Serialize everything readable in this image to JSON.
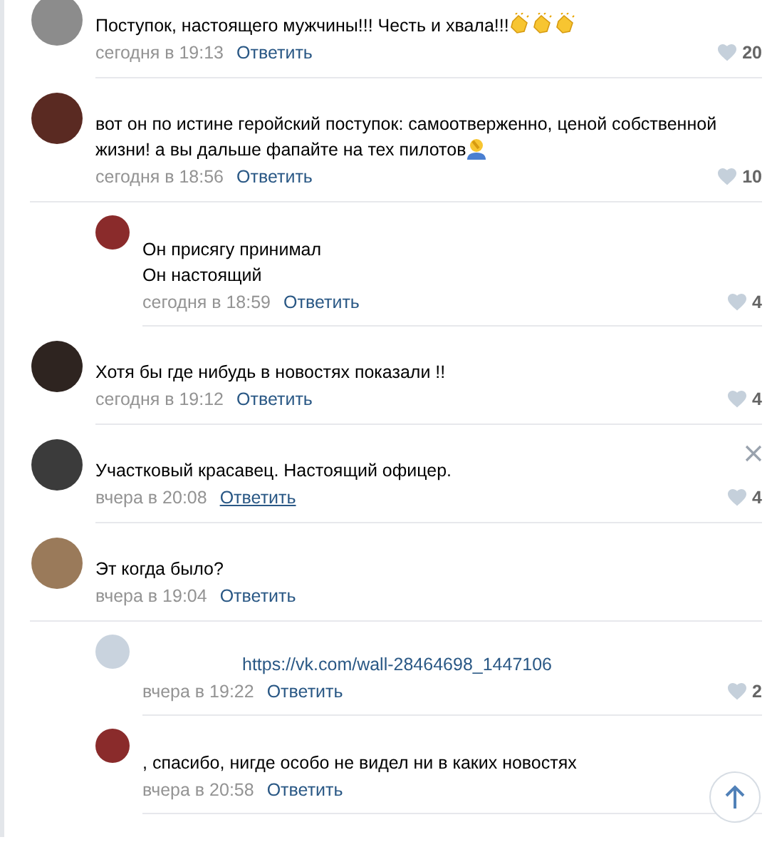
{
  "comments": [
    {
      "text": "Поступок, настоящего мужчины!!! Честь и хвала!!!",
      "icons": [
        {
          "kind": "clap"
        },
        {
          "kind": "clap"
        },
        {
          "kind": "clap"
        }
      ],
      "time": "сегодня в 19:13",
      "reply": "Ответить",
      "reply_underlined": false,
      "likes": "20",
      "closable": false
    },
    {
      "text": "вот он по истине геройский поступок: самоотверженно, ценой собственной жизни! а вы дальше фапайте на тех пилотов",
      "icons": [
        {
          "kind": "facepalm"
        }
      ],
      "time": "сегодня в 18:56",
      "reply": "Ответить",
      "reply_underlined": false,
      "likes": "10",
      "closable": false,
      "replies": [
        {
          "text": "Он присягу принимал\nОн настоящий",
          "kind": "text",
          "time": "сегодня в 18:59",
          "reply": "Ответить",
          "likes": "4"
        }
      ]
    },
    {
      "text": "Хотя бы где нибудь в новостях показали !!",
      "time": "сегодня в 19:12",
      "reply": "Ответить",
      "reply_underlined": false,
      "likes": "4",
      "closable": false
    },
    {
      "text": "Участковый красавец. Настоящий офицер.",
      "time": "вчера в 20:08",
      "reply": "Ответить",
      "reply_underlined": true,
      "likes": "4",
      "closable": true
    },
    {
      "text": "Эт когда было?",
      "time": "вчера в 19:04",
      "reply": "Ответить",
      "reply_underlined": false,
      "closable": false,
      "replies": [
        {
          "text": "https://vk.com/wall-28464698_1447106",
          "kind": "link",
          "time": "вчера в 19:22",
          "reply": "Ответить",
          "likes": "2"
        },
        {
          "text": ", спасибо, нигде особо не видел ни в каких новостях",
          "kind": "text",
          "time": "вчера в 20:58",
          "reply": "Ответить"
        }
      ]
    }
  ]
}
